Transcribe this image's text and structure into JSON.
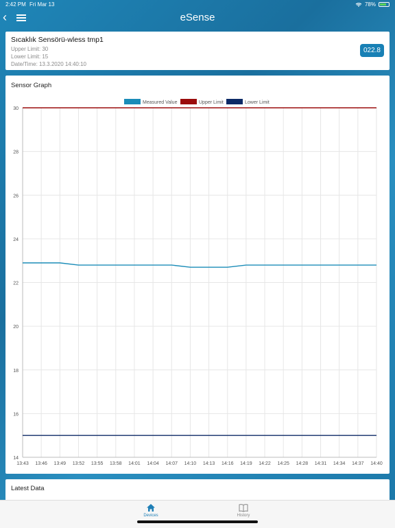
{
  "status_bar": {
    "time": "2:42 PM",
    "date": "Fri Mar 13",
    "battery": "78%",
    "battery_level": 0.78
  },
  "navbar": {
    "title": "eSense",
    "back_icon": "chevron-left-icon",
    "menu_icon": "hamburger-menu-icon"
  },
  "sensor": {
    "name": "Sıcaklık Sensörü-wless tmp1",
    "upper_limit": "Upper Limit: 30",
    "lower_limit": "Lower Limit: 15",
    "datetime": "Date/Time: 13.3.2020 14:40:10",
    "value": "022.8"
  },
  "graph_title": "Sensor Graph",
  "latest_title": "Latest Data",
  "tabs": [
    {
      "label": "Devices",
      "icon": "home-icon",
      "active": true
    },
    {
      "label": "History",
      "icon": "book-icon",
      "active": false
    }
  ],
  "colors": {
    "accent": "#1f7fb6",
    "measured": "#1a8cb8",
    "upper": "#9b0c0c",
    "lower": "#0d2a66"
  },
  "chart_data": {
    "type": "line",
    "x": [
      "13:43",
      "13:46",
      "13:49",
      "13:52",
      "13:55",
      "13:58",
      "14:01",
      "14:04",
      "14:07",
      "14:10",
      "14:13",
      "14:16",
      "14:19",
      "14:22",
      "14:25",
      "14:28",
      "14:31",
      "14:34",
      "14:37",
      "14:40"
    ],
    "series": [
      {
        "name": "Measured Value",
        "color": "#1a8cb8",
        "values": [
          22.9,
          22.9,
          22.9,
          22.8,
          22.8,
          22.8,
          22.8,
          22.8,
          22.8,
          22.7,
          22.7,
          22.7,
          22.8,
          22.8,
          22.8,
          22.8,
          22.8,
          22.8,
          22.8,
          22.8
        ]
      },
      {
        "name": "Upper Limit",
        "color": "#9b0c0c",
        "values": [
          30,
          30,
          30,
          30,
          30,
          30,
          30,
          30,
          30,
          30,
          30,
          30,
          30,
          30,
          30,
          30,
          30,
          30,
          30,
          30
        ]
      },
      {
        "name": "Lower Limit",
        "color": "#0d2a66",
        "values": [
          15,
          15,
          15,
          15,
          15,
          15,
          15,
          15,
          15,
          15,
          15,
          15,
          15,
          15,
          15,
          15,
          15,
          15,
          15,
          15
        ]
      }
    ],
    "yticks": [
      14,
      16,
      18,
      20,
      22,
      24,
      26,
      28,
      30
    ],
    "ylim": [
      14,
      30
    ],
    "grid": true,
    "legend": "top-center"
  }
}
